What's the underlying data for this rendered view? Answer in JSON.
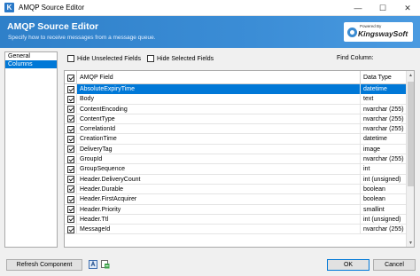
{
  "window": {
    "title": "AMQP Source Editor",
    "app_icon_glyph": "K",
    "minimize_glyph": "—",
    "maximize_glyph": "☐",
    "close_glyph": "✕"
  },
  "banner": {
    "title": "AMQP Source Editor",
    "subtitle": "Specify how to receive messages from a message queue.",
    "logo_powered": "Powered By",
    "logo_name": "KingswaySoft",
    "color": "#3585cf"
  },
  "nav": {
    "items": [
      {
        "label": "General",
        "selected": false
      },
      {
        "label": "Columns",
        "selected": true
      }
    ]
  },
  "options": {
    "hide_unselected": "Hide Unselected Fields",
    "hide_selected": "Hide Selected Fields",
    "find_label": "Find Column:",
    "find_value": ""
  },
  "grid": {
    "headers": {
      "field": "AMQP Field",
      "type": "Data Type"
    },
    "rows": [
      {
        "field": "AbsoluteExpiryTime",
        "type": "datetime",
        "selected": true
      },
      {
        "field": "Body",
        "type": "text",
        "selected": false
      },
      {
        "field": "ContentEncoding",
        "type": "nvarchar (255)",
        "selected": false
      },
      {
        "field": "ContentType",
        "type": "nvarchar (255)",
        "selected": false
      },
      {
        "field": "CorrelationId",
        "type": "nvarchar (255)",
        "selected": false
      },
      {
        "field": "CreationTime",
        "type": "datetime",
        "selected": false
      },
      {
        "field": "DeliveryTag",
        "type": "image",
        "selected": false
      },
      {
        "field": "GroupId",
        "type": "nvarchar (255)",
        "selected": false
      },
      {
        "field": "GroupSequence",
        "type": "int",
        "selected": false
      },
      {
        "field": "Header.DeliveryCount",
        "type": "int (unsigned)",
        "selected": false
      },
      {
        "field": "Header.Durable",
        "type": "boolean",
        "selected": false
      },
      {
        "field": "Header.FirstAcquirer",
        "type": "boolean",
        "selected": false
      },
      {
        "field": "Header.Priority",
        "type": "smallint",
        "selected": false
      },
      {
        "field": "Header.Ttl",
        "type": "int (unsigned)",
        "selected": false
      },
      {
        "field": "MessageId",
        "type": "nvarchar (255)",
        "selected": false
      }
    ]
  },
  "footer": {
    "refresh_label": "Refresh Component",
    "ok_label": "OK",
    "cancel_label": "Cancel"
  },
  "colors": {
    "accent": "#0078d7",
    "banner": "#3585cf"
  },
  "icons": [
    "app-icon",
    "minimize-icon",
    "maximize-icon",
    "close-icon",
    "help-icon",
    "export-icon",
    "scroll-up-icon",
    "scroll-down-icon"
  ]
}
